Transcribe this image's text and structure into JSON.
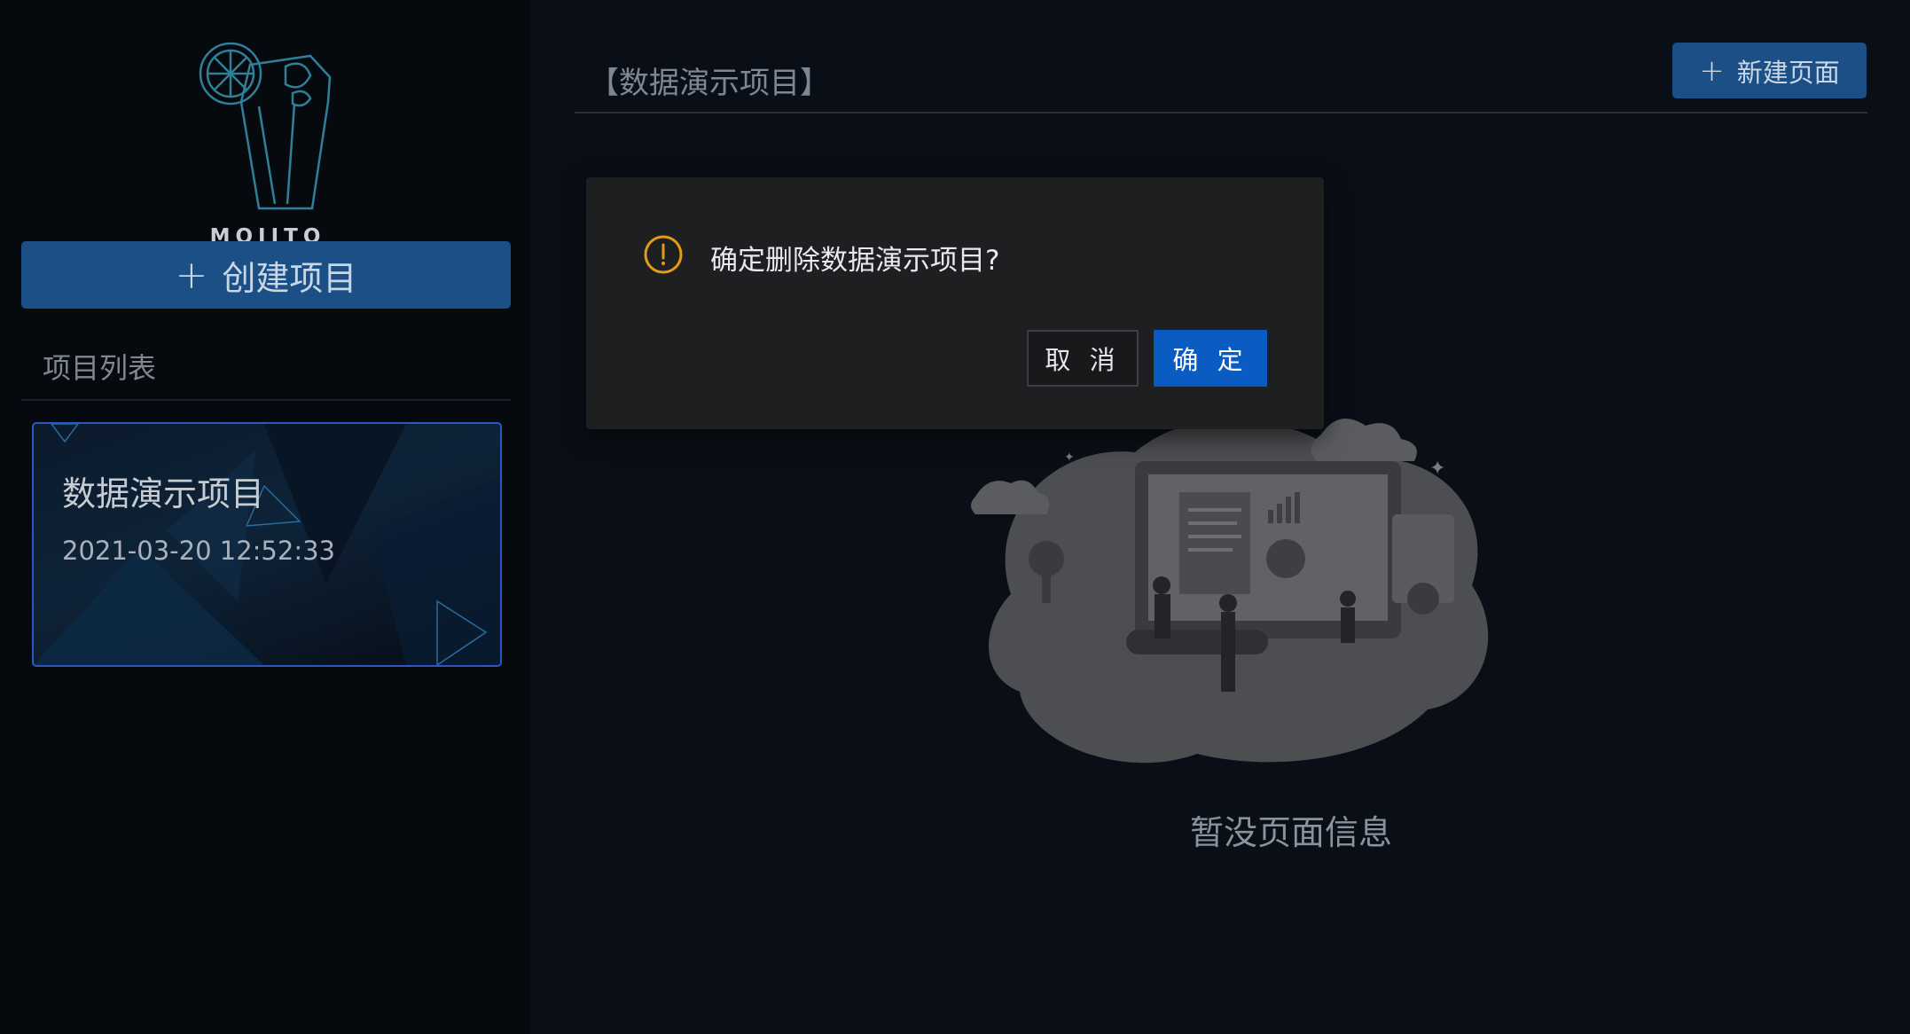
{
  "logo": {
    "brand": "MOJITO"
  },
  "sidebar": {
    "create_label": "创建项目",
    "list_heading": "项目列表",
    "projects": [
      {
        "name": "数据演示项目",
        "date": "2021-03-20 12:52:33"
      }
    ]
  },
  "main": {
    "header_title": "【数据演示项目】",
    "new_page_label": "新建页面",
    "empty_text": "暂没页面信息"
  },
  "dialog": {
    "message": "确定删除数据演示项目?",
    "cancel_label": "取 消",
    "ok_label": "确 定"
  },
  "colors": {
    "primary": "#1b4f86",
    "confirm": "#0a5bc2",
    "warning": "#e69b16",
    "card_border": "#2e56c2"
  }
}
